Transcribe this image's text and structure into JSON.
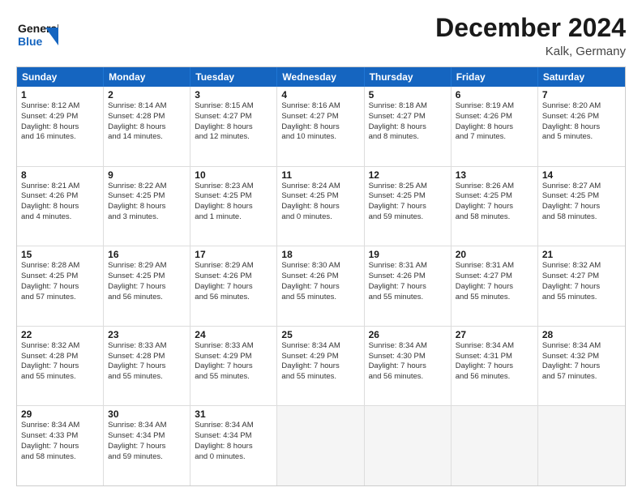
{
  "header": {
    "logo_general": "General",
    "logo_blue": "Blue",
    "title": "December 2024",
    "location": "Kalk, Germany"
  },
  "days_of_week": [
    "Sunday",
    "Monday",
    "Tuesday",
    "Wednesday",
    "Thursday",
    "Friday",
    "Saturday"
  ],
  "weeks": [
    [
      {
        "day": "1",
        "lines": [
          "Sunrise: 8:12 AM",
          "Sunset: 4:29 PM",
          "Daylight: 8 hours",
          "and 16 minutes."
        ]
      },
      {
        "day": "2",
        "lines": [
          "Sunrise: 8:14 AM",
          "Sunset: 4:28 PM",
          "Daylight: 8 hours",
          "and 14 minutes."
        ]
      },
      {
        "day": "3",
        "lines": [
          "Sunrise: 8:15 AM",
          "Sunset: 4:27 PM",
          "Daylight: 8 hours",
          "and 12 minutes."
        ]
      },
      {
        "day": "4",
        "lines": [
          "Sunrise: 8:16 AM",
          "Sunset: 4:27 PM",
          "Daylight: 8 hours",
          "and 10 minutes."
        ]
      },
      {
        "day": "5",
        "lines": [
          "Sunrise: 8:18 AM",
          "Sunset: 4:27 PM",
          "Daylight: 8 hours",
          "and 8 minutes."
        ]
      },
      {
        "day": "6",
        "lines": [
          "Sunrise: 8:19 AM",
          "Sunset: 4:26 PM",
          "Daylight: 8 hours",
          "and 7 minutes."
        ]
      },
      {
        "day": "7",
        "lines": [
          "Sunrise: 8:20 AM",
          "Sunset: 4:26 PM",
          "Daylight: 8 hours",
          "and 5 minutes."
        ]
      }
    ],
    [
      {
        "day": "8",
        "lines": [
          "Sunrise: 8:21 AM",
          "Sunset: 4:26 PM",
          "Daylight: 8 hours",
          "and 4 minutes."
        ]
      },
      {
        "day": "9",
        "lines": [
          "Sunrise: 8:22 AM",
          "Sunset: 4:25 PM",
          "Daylight: 8 hours",
          "and 3 minutes."
        ]
      },
      {
        "day": "10",
        "lines": [
          "Sunrise: 8:23 AM",
          "Sunset: 4:25 PM",
          "Daylight: 8 hours",
          "and 1 minute."
        ]
      },
      {
        "day": "11",
        "lines": [
          "Sunrise: 8:24 AM",
          "Sunset: 4:25 PM",
          "Daylight: 8 hours",
          "and 0 minutes."
        ]
      },
      {
        "day": "12",
        "lines": [
          "Sunrise: 8:25 AM",
          "Sunset: 4:25 PM",
          "Daylight: 7 hours",
          "and 59 minutes."
        ]
      },
      {
        "day": "13",
        "lines": [
          "Sunrise: 8:26 AM",
          "Sunset: 4:25 PM",
          "Daylight: 7 hours",
          "and 58 minutes."
        ]
      },
      {
        "day": "14",
        "lines": [
          "Sunrise: 8:27 AM",
          "Sunset: 4:25 PM",
          "Daylight: 7 hours",
          "and 58 minutes."
        ]
      }
    ],
    [
      {
        "day": "15",
        "lines": [
          "Sunrise: 8:28 AM",
          "Sunset: 4:25 PM",
          "Daylight: 7 hours",
          "and 57 minutes."
        ]
      },
      {
        "day": "16",
        "lines": [
          "Sunrise: 8:29 AM",
          "Sunset: 4:25 PM",
          "Daylight: 7 hours",
          "and 56 minutes."
        ]
      },
      {
        "day": "17",
        "lines": [
          "Sunrise: 8:29 AM",
          "Sunset: 4:26 PM",
          "Daylight: 7 hours",
          "and 56 minutes."
        ]
      },
      {
        "day": "18",
        "lines": [
          "Sunrise: 8:30 AM",
          "Sunset: 4:26 PM",
          "Daylight: 7 hours",
          "and 55 minutes."
        ]
      },
      {
        "day": "19",
        "lines": [
          "Sunrise: 8:31 AM",
          "Sunset: 4:26 PM",
          "Daylight: 7 hours",
          "and 55 minutes."
        ]
      },
      {
        "day": "20",
        "lines": [
          "Sunrise: 8:31 AM",
          "Sunset: 4:27 PM",
          "Daylight: 7 hours",
          "and 55 minutes."
        ]
      },
      {
        "day": "21",
        "lines": [
          "Sunrise: 8:32 AM",
          "Sunset: 4:27 PM",
          "Daylight: 7 hours",
          "and 55 minutes."
        ]
      }
    ],
    [
      {
        "day": "22",
        "lines": [
          "Sunrise: 8:32 AM",
          "Sunset: 4:28 PM",
          "Daylight: 7 hours",
          "and 55 minutes."
        ]
      },
      {
        "day": "23",
        "lines": [
          "Sunrise: 8:33 AM",
          "Sunset: 4:28 PM",
          "Daylight: 7 hours",
          "and 55 minutes."
        ]
      },
      {
        "day": "24",
        "lines": [
          "Sunrise: 8:33 AM",
          "Sunset: 4:29 PM",
          "Daylight: 7 hours",
          "and 55 minutes."
        ]
      },
      {
        "day": "25",
        "lines": [
          "Sunrise: 8:34 AM",
          "Sunset: 4:29 PM",
          "Daylight: 7 hours",
          "and 55 minutes."
        ]
      },
      {
        "day": "26",
        "lines": [
          "Sunrise: 8:34 AM",
          "Sunset: 4:30 PM",
          "Daylight: 7 hours",
          "and 56 minutes."
        ]
      },
      {
        "day": "27",
        "lines": [
          "Sunrise: 8:34 AM",
          "Sunset: 4:31 PM",
          "Daylight: 7 hours",
          "and 56 minutes."
        ]
      },
      {
        "day": "28",
        "lines": [
          "Sunrise: 8:34 AM",
          "Sunset: 4:32 PM",
          "Daylight: 7 hours",
          "and 57 minutes."
        ]
      }
    ],
    [
      {
        "day": "29",
        "lines": [
          "Sunrise: 8:34 AM",
          "Sunset: 4:33 PM",
          "Daylight: 7 hours",
          "and 58 minutes."
        ]
      },
      {
        "day": "30",
        "lines": [
          "Sunrise: 8:34 AM",
          "Sunset: 4:34 PM",
          "Daylight: 7 hours",
          "and 59 minutes."
        ]
      },
      {
        "day": "31",
        "lines": [
          "Sunrise: 8:34 AM",
          "Sunset: 4:34 PM",
          "Daylight: 8 hours",
          "and 0 minutes."
        ]
      },
      {
        "day": "",
        "lines": []
      },
      {
        "day": "",
        "lines": []
      },
      {
        "day": "",
        "lines": []
      },
      {
        "day": "",
        "lines": []
      }
    ]
  ]
}
